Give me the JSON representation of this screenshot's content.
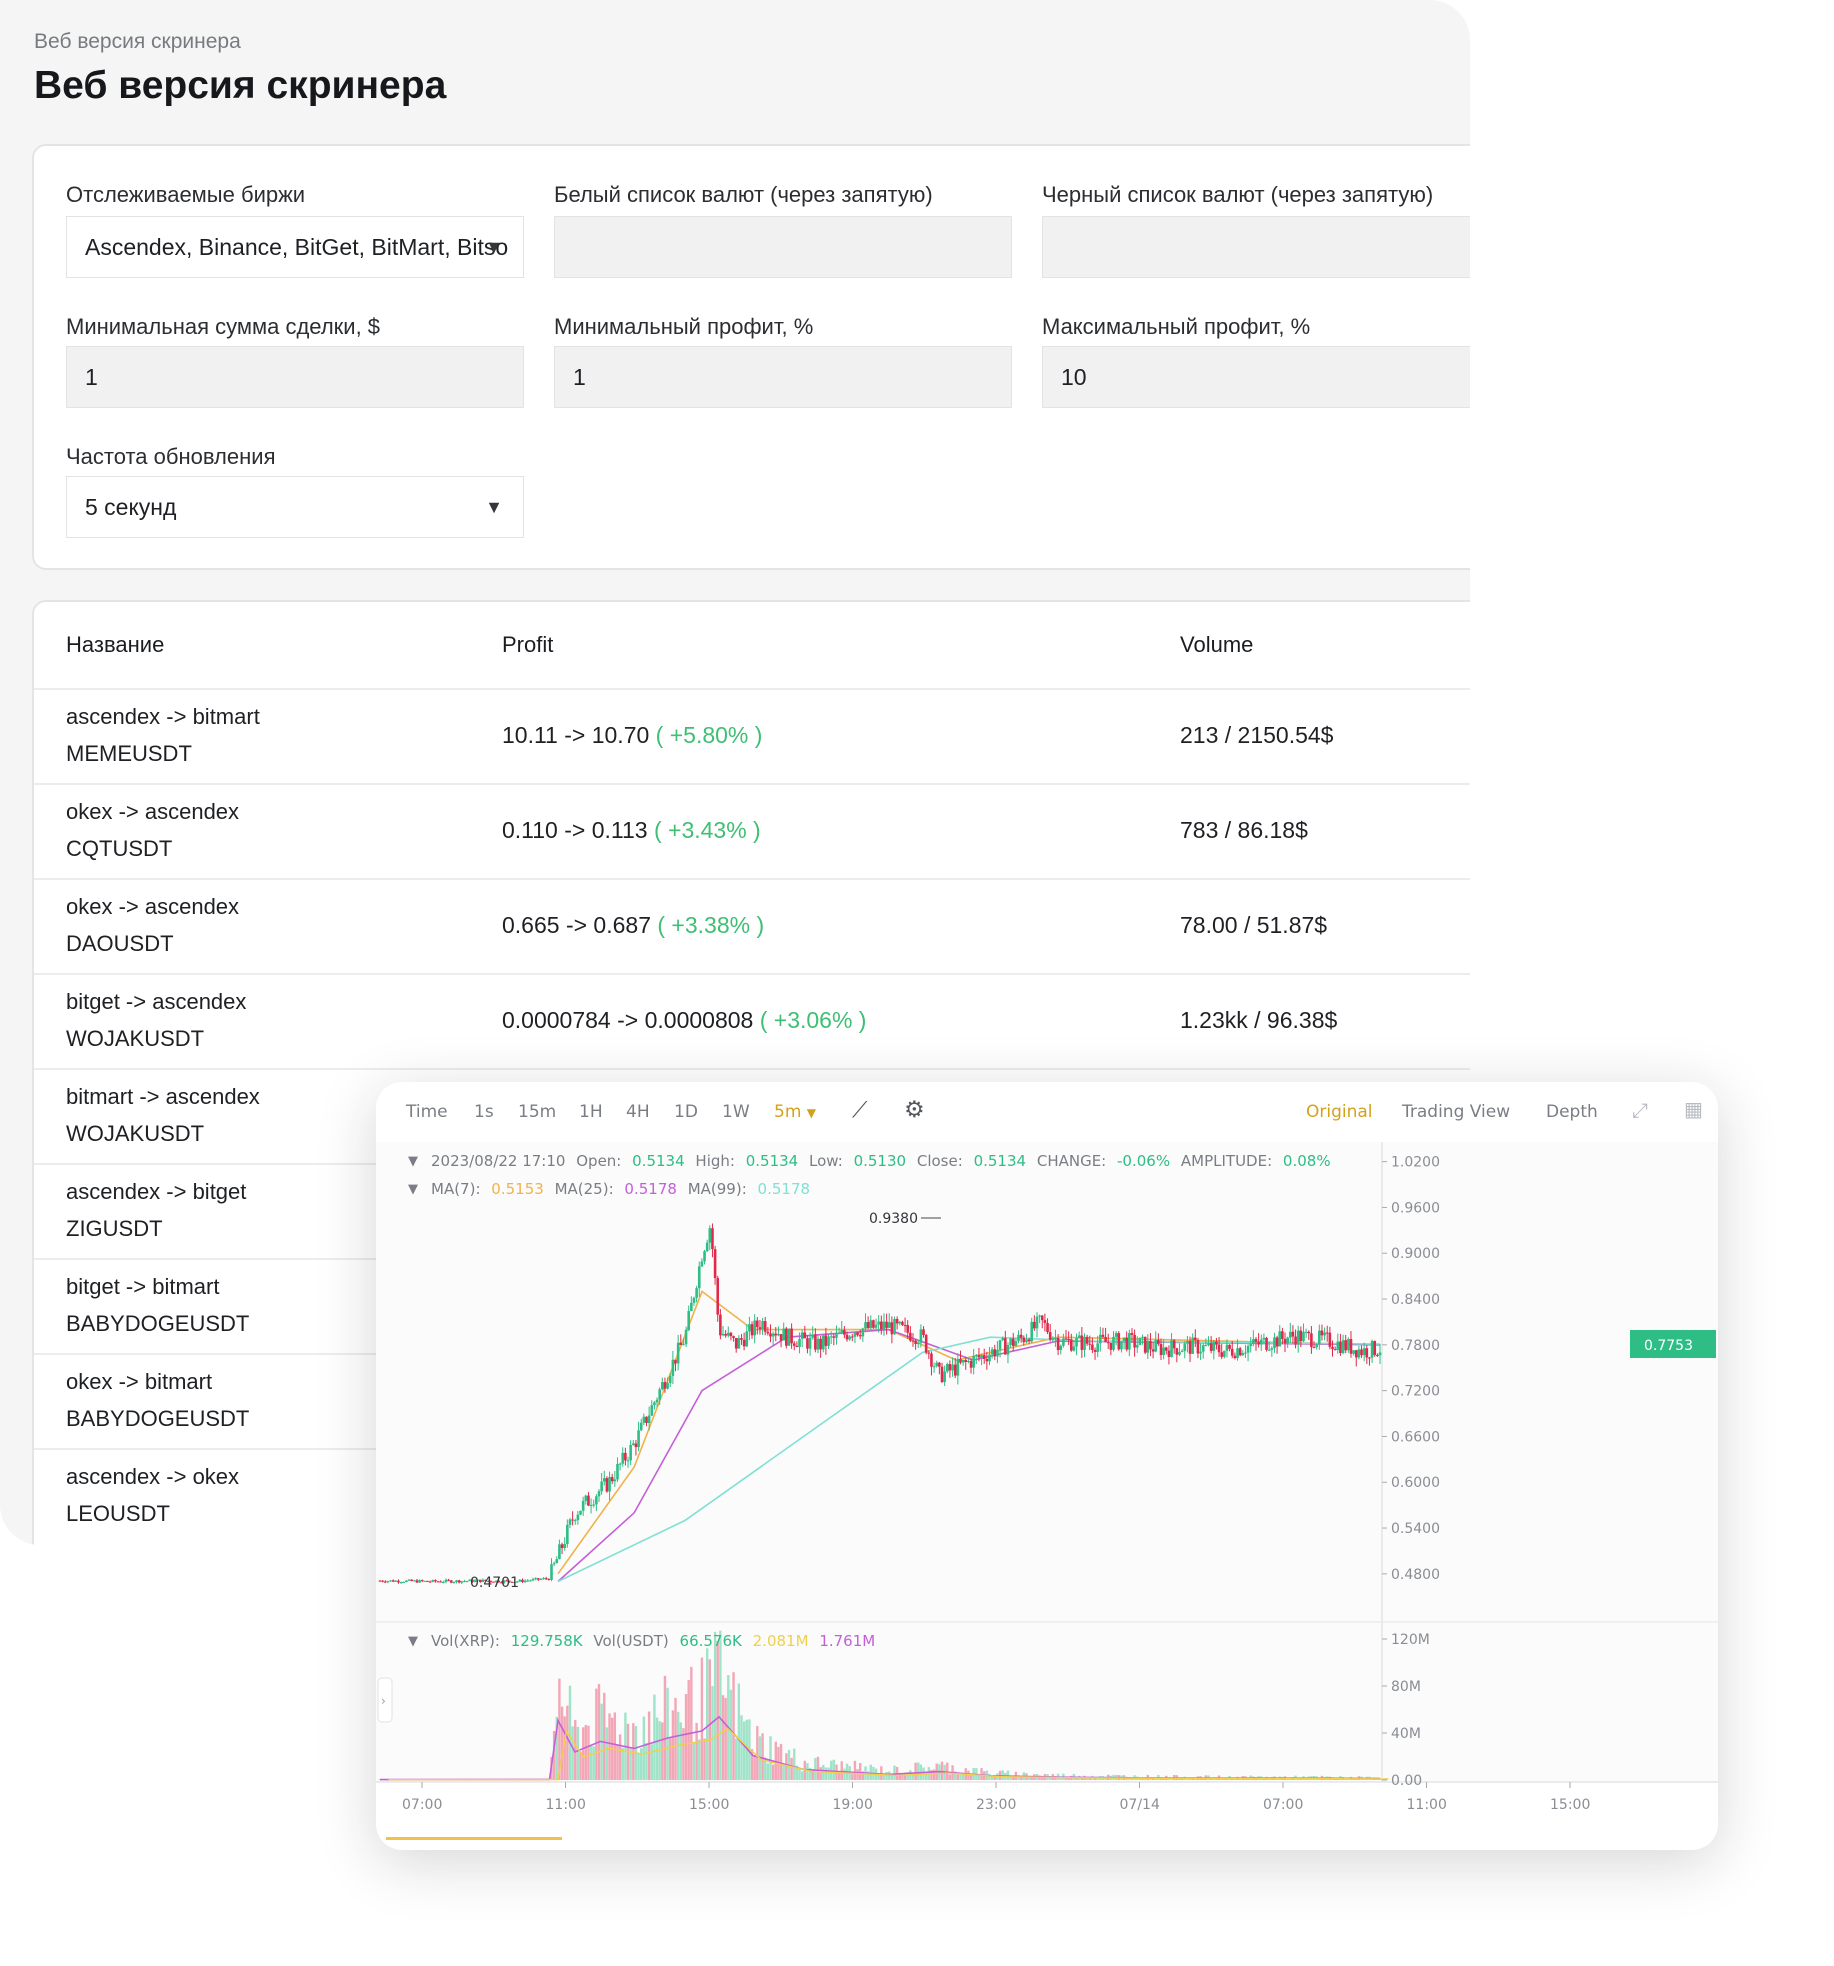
{
  "screener": {
    "breadcrumb": "Веб версия скринера",
    "title": "Веб версия скринера",
    "filters": {
      "exchanges_label": "Отслеживаемые биржи",
      "exchanges_value": "Ascendex, Binance, BitGet, BitMart, Bitsо",
      "whitelist_label": "Белый список валют (через запятую)",
      "whitelist_value": "",
      "blacklist_label": "Черный список валют (через запятую)",
      "blacklist_value": "",
      "min_amount_label": "Минимальная сумма сделки, $",
      "min_amount_value": "1",
      "min_profit_label": "Минимальный профит, %",
      "min_profit_value": "1",
      "max_profit_label": "Максимальный профит, %",
      "max_profit_value": "10",
      "refresh_label": "Частота обновления",
      "refresh_value": "5 секунд"
    },
    "table": {
      "columns": [
        "Название",
        "Profit",
        "Volume"
      ],
      "rows": [
        {
          "route": "ascendex -> bitmart",
          "pair": "MEMEUSDT",
          "profit": "10.11 -> 10.70",
          "pct": "( +5.80% )",
          "volume": "213 / 2150.54$"
        },
        {
          "route": "okex -> ascendex",
          "pair": "CQTUSDT",
          "profit": "0.110 -> 0.113",
          "pct": "( +3.43% )",
          "volume": "783 / 86.18$"
        },
        {
          "route": "okex -> ascendex",
          "pair": "DAOUSDT",
          "profit": "0.665 -> 0.687",
          "pct": "( +3.38% )",
          "volume": "78.00 / 51.87$"
        },
        {
          "route": "bitget -> ascendex",
          "pair": "WOJAKUSDT",
          "profit": "0.0000784 -> 0.0000808",
          "pct": "( +3.06% )",
          "volume": "1.23kk / 96.38$"
        },
        {
          "route": "bitmart -> ascendex",
          "pair": "WOJAKUSDT",
          "profit": "",
          "pct": "",
          "volume": ""
        },
        {
          "route": "ascendex -> bitget",
          "pair": "ZIGUSDT",
          "profit": "",
          "pct": "",
          "volume": ""
        },
        {
          "route": "bitget -> bitmart",
          "pair": "BABYDOGEUSDT",
          "profit": "",
          "pct": "",
          "volume": ""
        },
        {
          "route": "okex -> bitmart",
          "pair": "BABYDOGEUSDT",
          "profit": "",
          "pct": "",
          "volume": ""
        },
        {
          "route": "ascendex -> okex",
          "pair": "LEOUSDT",
          "profit": "",
          "pct": "",
          "volume": ""
        }
      ]
    }
  },
  "chart_widget": {
    "intervals": [
      "Time",
      "1s",
      "15m",
      "1H",
      "4H",
      "1D",
      "1W"
    ],
    "active_interval": "5m",
    "views": [
      "Original",
      "Trading View",
      "Depth"
    ],
    "active_view": "Original",
    "ohlc": {
      "date": "2023/08/22 17:10",
      "open_label": "Open:",
      "open": "0.5134",
      "high_label": "High:",
      "high": "0.5134",
      "low_label": "Low:",
      "low": "0.5130",
      "close_label": "Close:",
      "close": "0.5134",
      "change_label": "CHANGE:",
      "change": "-0.06%",
      "amplitude_label": "AMPLITUDE:",
      "amplitude": "0.08%"
    },
    "ma": {
      "ma7_label": "MA(7):",
      "ma7": "0.5153",
      "ma25_label": "MA(25):",
      "ma25": "0.5178",
      "ma99_label": "MA(99):",
      "ma99": "0.5178"
    },
    "vol": {
      "xrp_label": "Vol(XRP):",
      "xrp": "129.758K",
      "usdt_label": "Vol(USDT)",
      "usdt": "66.576K",
      "ma1": "2.081M",
      "ma2": "1.761M"
    },
    "high_marker": "0.9380",
    "low_marker": "0.4701",
    "last_price": "0.7753",
    "colors": {
      "up": "#2ebd85",
      "down": "#e0294a",
      "ma7": "#f0b24a",
      "ma25": "#c45fd8",
      "ma99": "#7fe0d4",
      "accent": "#d4a21a"
    }
  },
  "chart_data": {
    "type": "candlestick",
    "price_axis": [
      "1.0200",
      "0.9600",
      "0.9000",
      "0.8400",
      "0.7800",
      "0.7200",
      "0.6600",
      "0.6000",
      "0.5400",
      "0.4800"
    ],
    "volume_axis": [
      "120M",
      "80M",
      "40M",
      "0.00"
    ],
    "time_axis": [
      "07:00",
      "11:00",
      "15:00",
      "19:00",
      "23:00",
      "07/14",
      "07:00",
      "11:00",
      "15:00"
    ],
    "ylim": [
      0.43,
      1.03
    ],
    "price_path": [
      [
        0,
        0.471
      ],
      [
        0.3,
        0.47
      ],
      [
        0.6,
        0.471
      ],
      [
        0.8,
        0.47
      ],
      [
        0.9,
        0.472
      ],
      [
        1.0,
        0.474
      ],
      [
        1.15,
        0.56
      ],
      [
        1.35,
        0.6
      ],
      [
        1.5,
        0.65
      ],
      [
        1.65,
        0.72
      ],
      [
        1.8,
        0.79
      ],
      [
        1.9,
        0.9
      ],
      [
        1.95,
        0.938
      ],
      [
        2.0,
        0.8
      ],
      [
        2.1,
        0.78
      ],
      [
        2.25,
        0.81
      ],
      [
        2.4,
        0.79
      ],
      [
        2.6,
        0.78
      ],
      [
        2.8,
        0.8
      ],
      [
        3.0,
        0.805
      ],
      [
        3.2,
        0.79
      ],
      [
        3.3,
        0.74
      ],
      [
        3.4,
        0.75
      ],
      [
        3.6,
        0.77
      ],
      [
        3.8,
        0.79
      ],
      [
        3.9,
        0.81
      ],
      [
        4.0,
        0.785
      ],
      [
        4.2,
        0.782
      ],
      [
        4.4,
        0.785
      ],
      [
        4.6,
        0.775
      ],
      [
        4.8,
        0.778
      ],
      [
        5.0,
        0.772
      ],
      [
        5.2,
        0.782
      ],
      [
        5.4,
        0.792
      ],
      [
        5.6,
        0.785
      ],
      [
        5.8,
        0.772
      ],
      [
        5.9,
        0.7753
      ]
    ],
    "volume_path": [
      [
        0,
        0.5
      ],
      [
        1.0,
        0.8
      ],
      [
        1.05,
        85
      ],
      [
        1.15,
        40
      ],
      [
        1.3,
        55
      ],
      [
        1.5,
        45
      ],
      [
        1.7,
        60
      ],
      [
        1.9,
        70
      ],
      [
        2.0,
        90
      ],
      [
        2.2,
        35
      ],
      [
        2.5,
        15
      ],
      [
        3.0,
        8
      ],
      [
        3.3,
        12
      ],
      [
        3.6,
        6
      ],
      [
        4.0,
        4
      ],
      [
        4.5,
        3
      ],
      [
        5.0,
        2.5
      ],
      [
        5.5,
        2.5
      ],
      [
        5.9,
        2
      ]
    ],
    "ma_paths": {
      "ma7": [
        [
          1.05,
          0.48
        ],
        [
          1.5,
          0.62
        ],
        [
          1.9,
          0.85
        ],
        [
          2.2,
          0.8
        ],
        [
          3.0,
          0.8
        ],
        [
          3.4,
          0.76
        ],
        [
          4.0,
          0.79
        ],
        [
          5.9,
          0.78
        ]
      ],
      "ma25": [
        [
          1.05,
          0.47
        ],
        [
          1.5,
          0.56
        ],
        [
          1.9,
          0.72
        ],
        [
          2.4,
          0.79
        ],
        [
          3.0,
          0.8
        ],
        [
          3.5,
          0.76
        ],
        [
          4.0,
          0.785
        ],
        [
          5.9,
          0.78
        ]
      ],
      "ma99": [
        [
          1.05,
          0.47
        ],
        [
          1.8,
          0.55
        ],
        [
          2.5,
          0.66
        ],
        [
          3.2,
          0.77
        ],
        [
          3.6,
          0.79
        ],
        [
          4.2,
          0.785
        ],
        [
          5.9,
          0.781
        ]
      ]
    }
  }
}
